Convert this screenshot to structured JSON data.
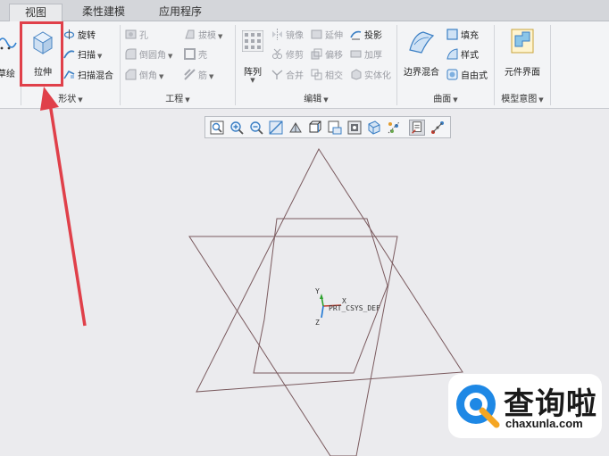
{
  "tabs": [
    "视图",
    "柔性建模",
    "应用程序"
  ],
  "ribbon": {
    "sketch_label": "草绘",
    "shape": {
      "label": "形状",
      "extrude": "拉伸",
      "revolve": "旋转",
      "sweep": "扫描",
      "swept_blend": "扫描混合"
    },
    "engineering": {
      "label": "工程",
      "hole": "孔",
      "draft": "拔模",
      "round": "倒圆角",
      "shell": "壳",
      "chamfer": "倒角",
      "rib": "筋"
    },
    "editing": {
      "label": "编辑",
      "pattern": "阵列",
      "mirror": "镜像",
      "extend": "延伸",
      "project": "投影",
      "trim": "修剪",
      "offset": "偏移",
      "thicken": "加厚",
      "merge": "合并",
      "intersect": "相交",
      "solidify": "实体化"
    },
    "surfaces": {
      "label": "曲面",
      "boundary_blend": "边界混合",
      "fill": "填充",
      "style": "样式",
      "freestyle": "自由式"
    },
    "model_intent": {
      "label": "模型意图",
      "component_interface": "元件界面"
    }
  },
  "canvas": {
    "csys_label": "PRT_CSYS_DEF",
    "axis_x": "X",
    "axis_y": "Y",
    "axis_z": "Z"
  },
  "watermark": {
    "brand": "查询啦",
    "url": "chaxunla.com"
  },
  "colors": {
    "highlight": "#e0404a",
    "sketch_lines": "#7a5a5e",
    "canvas_bg": "#ebebee"
  }
}
